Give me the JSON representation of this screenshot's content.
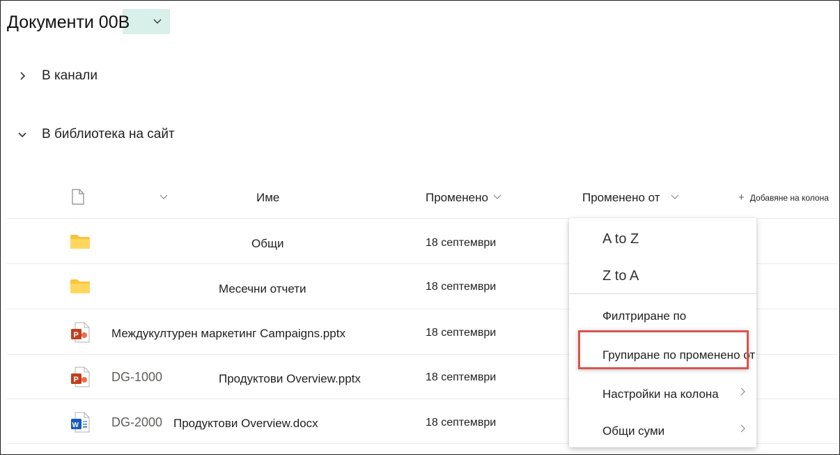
{
  "library": {
    "title": "Документи 00В"
  },
  "sections": [
    {
      "label": "В канали",
      "expanded": false
    },
    {
      "label": "В библиотека на сайт",
      "expanded": true
    }
  ],
  "columns": {
    "name": "Име",
    "modified": "Променено",
    "modified_by": "Променено от",
    "add_column": "Добавяне на колона"
  },
  "rows": [
    {
      "type": "folder",
      "id": "",
      "name": "Общи",
      "modified": "18 септември"
    },
    {
      "type": "folder",
      "id": "",
      "name": "Месечни отчети",
      "modified": "18 септември"
    },
    {
      "type": "pptx",
      "id": "",
      "name": "Междукултурен маркетинг Campaigns.pptx",
      "modified": "18 септември"
    },
    {
      "type": "pptx",
      "id": "DG-1000",
      "name": "Продуктови Overview.pptx",
      "modified": "18 септември"
    },
    {
      "type": "docx",
      "id": "DG-2000",
      "name": "Продуктови Overview.docx",
      "modified": "18 септември"
    }
  ],
  "menu": {
    "a_to_z": "A to Z",
    "z_to_a": "Z to A",
    "filter_by": "Филтриране по",
    "group_by": "Групиране по променено от",
    "column_settings": "Настройки на колона",
    "totals": "Общи суми"
  },
  "colors": {
    "title_highlight": "#d9efe9",
    "folder": "#f8c53a",
    "powerpoint": "#c43e1c",
    "word": "#185abd",
    "highlight_box": "#d9534f"
  }
}
